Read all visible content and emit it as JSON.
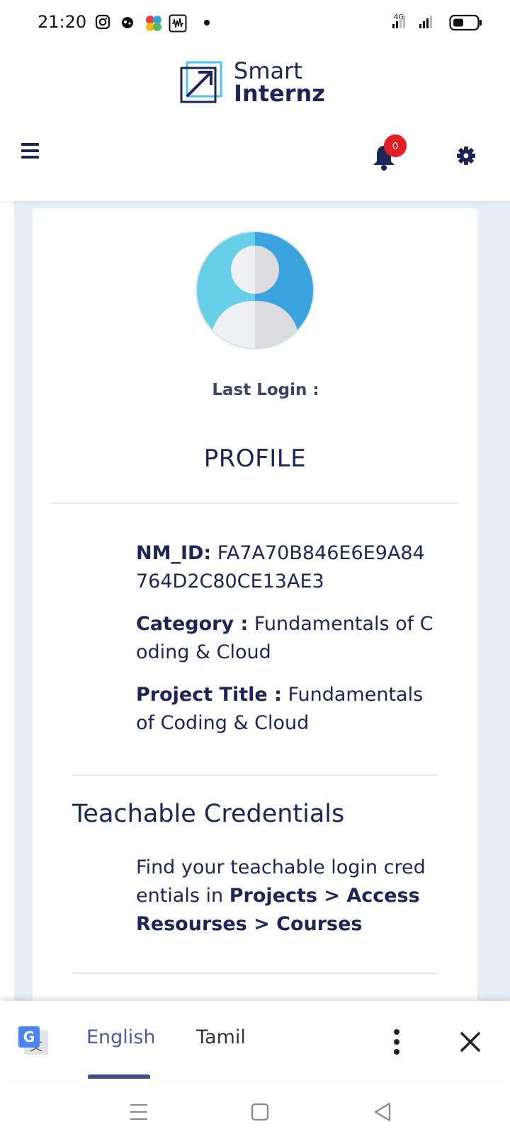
{
  "status_bar": {
    "time": "21:20",
    "network": "4G",
    "icons": [
      "instagram-icon",
      "app-icon",
      "pinwheel-icon",
      "waveform-icon",
      "signal-icon",
      "battery-icon"
    ]
  },
  "logo": {
    "line1": "Smart",
    "line2": "Internz"
  },
  "nav": {
    "notification_count": "0",
    "icons": [
      "hamburger-icon",
      "bell-icon",
      "gear-icon"
    ]
  },
  "profile": {
    "last_login_label": "Last Login :",
    "title": "PROFILE",
    "nm_id_label": "NM_ID:",
    "nm_id_value": "FA7A70B846E6E9A84764D2C80CE13AE3",
    "category_label": "Category :",
    "category_value": "Fundamentals of Coding & Cloud",
    "project_label": "Project Title :",
    "project_value": "Fundamentals of Coding & Cloud"
  },
  "credentials": {
    "title": "Teachable Credentials",
    "text_prefix": "Find your teachable login credentials in",
    "path": "Projects > Access Resourses > Courses"
  },
  "translate_bar": {
    "active_language": "English",
    "other_language": "Tamil"
  },
  "colors": {
    "brand": "#1b2657",
    "badge": "#e41d23",
    "page_bg": "#e9eef6",
    "avatar_light": "#67cfe8",
    "avatar_dark": "#3aa3dd"
  }
}
